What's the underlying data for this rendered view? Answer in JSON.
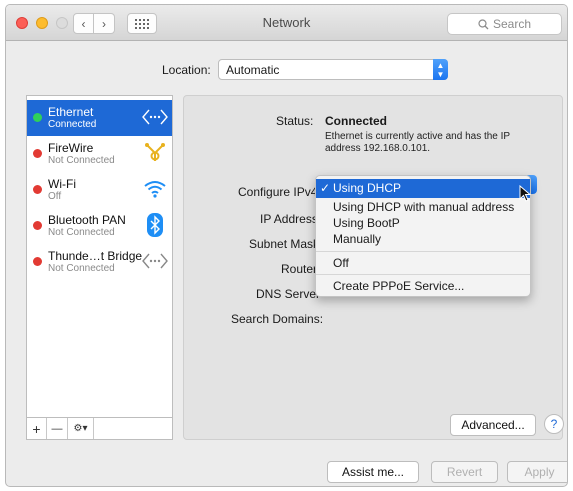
{
  "window": {
    "title": "Network"
  },
  "toolbar": {
    "search_placeholder": "Search",
    "back": "‹",
    "forward": "›"
  },
  "location": {
    "label": "Location:",
    "value": "Automatic"
  },
  "services": [
    {
      "name": "Ethernet",
      "status": "Connected",
      "selected": true,
      "icon": "ethernet-icon"
    },
    {
      "name": "FireWire",
      "status": "Not Connected",
      "selected": false,
      "icon": "firewire-icon"
    },
    {
      "name": "Wi-Fi",
      "status": "Off",
      "selected": false,
      "icon": "wifi-icon"
    },
    {
      "name": "Bluetooth PAN",
      "status": "Not Connected",
      "selected": false,
      "icon": "bluetooth-icon"
    },
    {
      "name": "Thunde…t Bridge",
      "status": "Not Connected",
      "selected": false,
      "icon": "thunderbolt-bridge-icon"
    }
  ],
  "sidebar_controls": {
    "add": "+",
    "remove": "—",
    "action": "⚙▾"
  },
  "details": {
    "status_label": "Status:",
    "status_value": "Connected",
    "status_description": "Ethernet is currently active and has the IP address 192.168.0.101.",
    "configure_label": "Configure IPv4",
    "ip_label": "IP Address",
    "subnet_label": "Subnet Mask",
    "router_label": "Router",
    "dns_label": "DNS Server",
    "search_domains_label": "Search Domains:"
  },
  "ipv4_menu": {
    "check": "✓",
    "items": [
      "Using DHCP",
      "Using DHCP with manual address",
      "Using BootP",
      "Manually",
      "Off",
      "Create PPPoE Service..."
    ],
    "selected": "Using DHCP"
  },
  "buttons": {
    "advanced": "Advanced...",
    "help": "?",
    "assist": "Assist me...",
    "revert": "Revert",
    "apply": "Apply"
  },
  "colors": {
    "accent": "#1e69d6",
    "connected": "#2fd05a",
    "disconnected": "#e23a33"
  }
}
